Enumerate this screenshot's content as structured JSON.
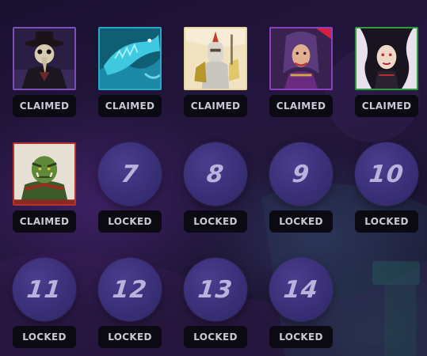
{
  "rewards": [
    {
      "state": "claimed",
      "label": "CLAIMED",
      "art": "plague-doctor",
      "rarity_color": "#7a4fb8"
    },
    {
      "state": "claimed",
      "label": "CLAIMED",
      "art": "sea-serpent",
      "rarity_color": "#2aa8c8"
    },
    {
      "state": "claimed",
      "label": "CLAIMED",
      "art": "paladin-knight",
      "rarity_color": "#e8d7a0"
    },
    {
      "state": "claimed",
      "label": "CLAIMED",
      "art": "sorceress",
      "rarity_color": "#8c3fc0"
    },
    {
      "state": "claimed",
      "label": "CLAIMED",
      "art": "dark-witch",
      "rarity_color": "#2e9e3a"
    },
    {
      "state": "claimed",
      "label": "CLAIMED",
      "art": "orc-warrior",
      "rarity_color": "#b8302a"
    },
    {
      "state": "locked",
      "label": "LOCKED",
      "number": "7"
    },
    {
      "state": "locked",
      "label": "LOCKED",
      "number": "8"
    },
    {
      "state": "locked",
      "label": "LOCKED",
      "number": "9"
    },
    {
      "state": "locked",
      "label": "LOCKED",
      "number": "10"
    },
    {
      "state": "locked",
      "label": "LOCKED",
      "number": "11"
    },
    {
      "state": "locked",
      "label": "LOCKED",
      "number": "12"
    },
    {
      "state": "locked",
      "label": "LOCKED",
      "number": "13"
    },
    {
      "state": "locked",
      "label": "LOCKED",
      "number": "14"
    }
  ]
}
